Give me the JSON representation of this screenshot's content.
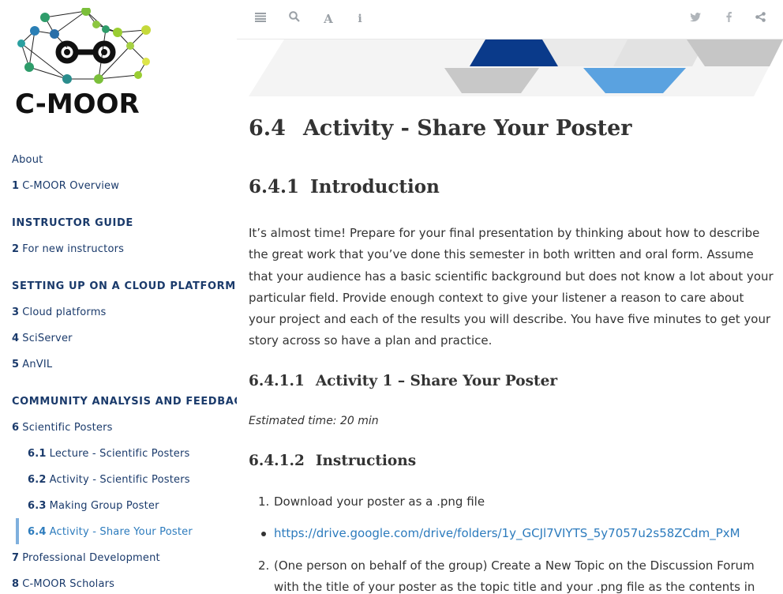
{
  "logo": {
    "text": "C-MOOR"
  },
  "toc": {
    "about": "About",
    "items": [
      {
        "num": "1",
        "label": "C-MOOR Overview"
      },
      {
        "header": "INSTRUCTOR GUIDE"
      },
      {
        "num": "2",
        "label": "For new instructors"
      },
      {
        "header": "SETTING UP ON A CLOUD PLATFORM"
      },
      {
        "num": "3",
        "label": "Cloud platforms"
      },
      {
        "num": "4",
        "label": "SciServer"
      },
      {
        "num": "5",
        "label": "AnVIL"
      },
      {
        "header": "COMMUNITY ANALYSIS AND FEEDBACK"
      },
      {
        "num": "6",
        "label": "Scientific Posters"
      },
      {
        "num": "6.1",
        "label": "Lecture - Scientific Posters"
      },
      {
        "num": "6.2",
        "label": "Activity - Scientific Posters"
      },
      {
        "num": "6.3",
        "label": "Making Group Poster"
      },
      {
        "num": "6.4",
        "label": "Activity - Share Your Poster"
      },
      {
        "num": "7",
        "label": "Professional Development"
      },
      {
        "num": "8",
        "label": "C-MOOR Scholars"
      }
    ]
  },
  "toolbar": {
    "icons": [
      "toc-toggle-icon",
      "search-icon",
      "font-icon",
      "info-icon",
      "twitter-icon",
      "facebook-icon",
      "share-icon"
    ]
  },
  "content": {
    "h2_num": "6.4",
    "h2_title": "Activity - Share Your Poster",
    "h3_num": "6.4.1",
    "h3_title": "Introduction",
    "intro": "It’s almost time! Prepare for your final presentation by thinking about how to describe the great work that you’ve done this semester in both written and oral form. Assume that your audience has a basic scientific background but does not know a lot about your particular field. Provide enough context to give your listener a reason to care about your project and each of the results you will describe. You have five minutes to get your story across so have a plan and practice.",
    "h4a_num": "6.4.1.1",
    "h4a_title": "Activity 1 – Share Your Poster",
    "estimated": "Estimated time: 20 min",
    "h4b_num": "6.4.1.2",
    "h4b_title": "Instructions",
    "step1_num": "1.",
    "step1": "Download your poster as a .png file",
    "step1_link": "https://drive.google.com/drive/folders/1y_GCJl7VIYTS_5y7057u2s58ZCdm_PxM",
    "step2_num": "2.",
    "step2_line1": "(One person on behalf of the group) Create a New Topic on the Discussion Forum",
    "step2_line2": "with the title of your poster as the topic title and your .png file as the contents in"
  }
}
